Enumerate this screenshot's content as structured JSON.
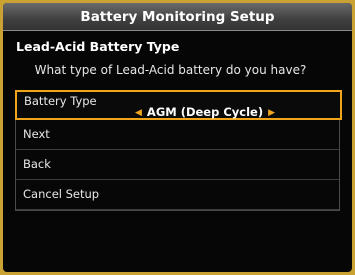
{
  "window": {
    "title": "Battery Monitoring Setup"
  },
  "section": {
    "title": "Lead-Acid Battery Type"
  },
  "prompt": {
    "question": "What type of Lead-Acid battery do you have?"
  },
  "menu": {
    "battery_type": {
      "label": "Battery Type",
      "value": "AGM (Deep Cycle)",
      "left_arrow": "◀",
      "right_arrow": "▶"
    },
    "next_label": "Next",
    "back_label": "Back",
    "cancel_label": "Cancel Setup"
  },
  "colors": {
    "accent": "#f0a51a",
    "border_outer": "#c9a233",
    "background": "#060606",
    "titlebar": "#4a4a4a"
  }
}
